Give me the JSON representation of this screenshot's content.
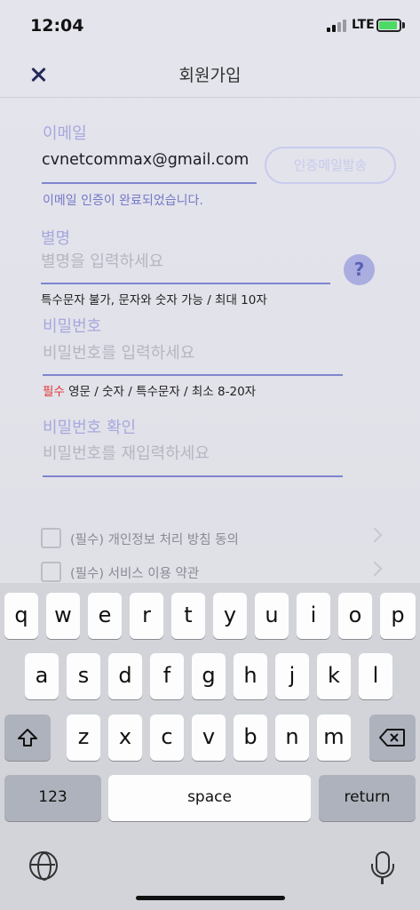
{
  "status": {
    "time": "12:04",
    "network": "LTE"
  },
  "nav": {
    "title": "회원가입",
    "close_icon": "close-icon"
  },
  "email": {
    "label": "이메일",
    "value": "cvnetcommax@gmail.com",
    "verify_button": "인증메일발송",
    "status": "이메일 인증이 완료되었습니다."
  },
  "nickname": {
    "label": "별명",
    "placeholder": "별명을 입력하세요",
    "help": "?",
    "hint": "특수문자 불가, 문자와 숫자 가능 / 최대 10자"
  },
  "password": {
    "label": "비밀번호",
    "placeholder": "비밀번호를 입력하세요",
    "hint_required": "필수",
    "hint": " 영문 / 숫자 / 특수문자 / 최소 8-20자"
  },
  "password_confirm": {
    "label": "비밀번호 확인",
    "placeholder": "비밀번호를 재입력하세요"
  },
  "agreements": [
    {
      "label": "(필수) 개인정보 처리 방침 동의"
    },
    {
      "label": "(필수) 서비스 이용 약관"
    }
  ],
  "keyboard": {
    "row1": [
      "q",
      "w",
      "e",
      "r",
      "t",
      "y",
      "u",
      "i",
      "o",
      "p"
    ],
    "row2": [
      "a",
      "s",
      "d",
      "f",
      "g",
      "h",
      "j",
      "k",
      "l"
    ],
    "row3": [
      "z",
      "x",
      "c",
      "v",
      "b",
      "n",
      "m"
    ],
    "numbers": "123",
    "space": "space",
    "return": "return",
    "shift_icon": "shift-icon",
    "backspace_icon": "backspace-icon",
    "globe_icon": "globe-icon",
    "mic_icon": "microphone-icon"
  },
  "colors": {
    "accent": "#7f84cf",
    "label": "#a6a8de",
    "required": "#e1322e",
    "battery": "#4cd964"
  }
}
